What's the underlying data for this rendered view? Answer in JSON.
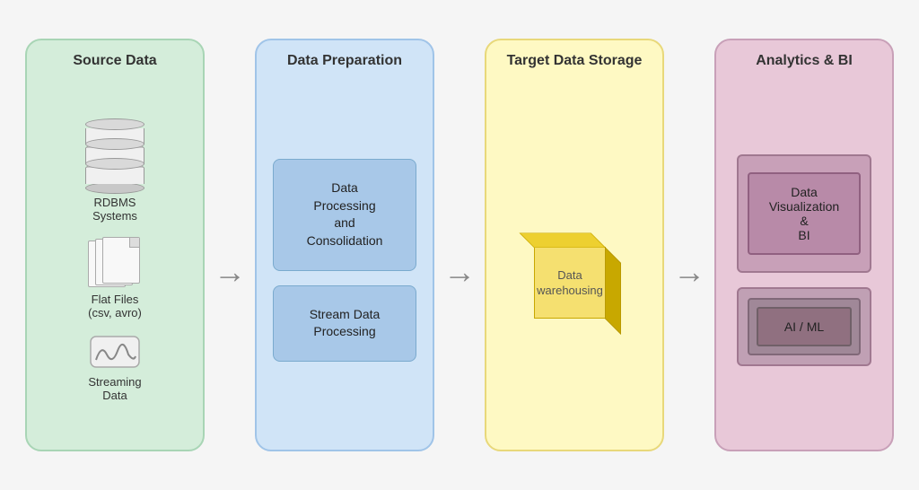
{
  "columns": {
    "source": {
      "title": "Source Data",
      "items": [
        {
          "label": "RDBMS\nSystems",
          "type": "database"
        },
        {
          "label": "Flat Files\n(csv, avro)",
          "type": "files"
        },
        {
          "label": "Streaming\nData",
          "type": "stream"
        }
      ]
    },
    "preparation": {
      "title": "Data Preparation",
      "items": [
        {
          "label": "Data\nProcessing\nand\nConsolidation"
        },
        {
          "label": "Stream Data\nProcessing"
        }
      ]
    },
    "target": {
      "title": "Target Data Storage",
      "warehouse_label": "Data\nwarehousing"
    },
    "analytics": {
      "title": "Analytics & BI",
      "items": [
        {
          "label": "Data\nVisualization\n&\nBI"
        },
        {
          "label": "AI / ML"
        }
      ]
    }
  },
  "arrows": [
    "→",
    "→",
    "→"
  ]
}
